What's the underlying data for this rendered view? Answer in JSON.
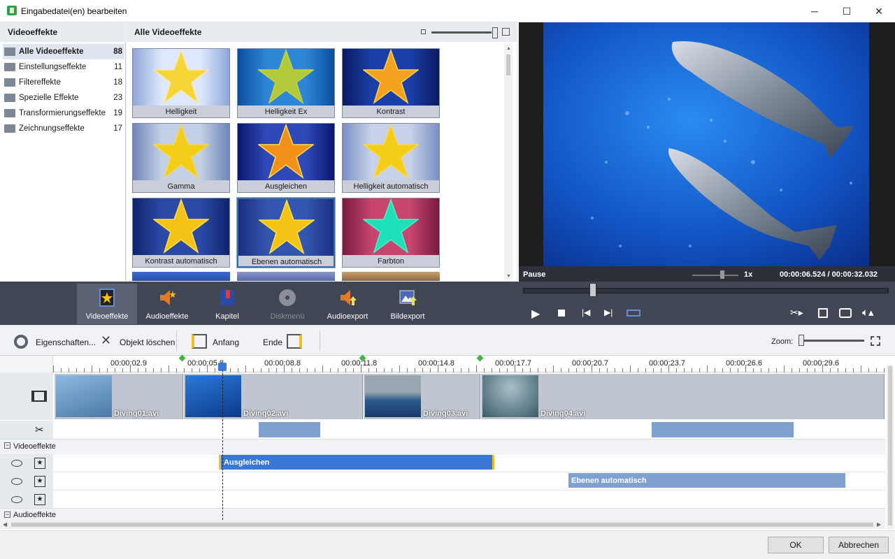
{
  "window": {
    "title": "Eingabedatei(en) bearbeiten",
    "minimize": "─",
    "maximize": "☐",
    "close": "✕"
  },
  "categories": {
    "header": "Videoeffekte",
    "items": [
      {
        "label": "Alle Videoeffekte",
        "count": "88"
      },
      {
        "label": "Einstellungseffekte",
        "count": "11"
      },
      {
        "label": "Filtereffekte",
        "count": "18"
      },
      {
        "label": "Spezielle Effekte",
        "count": "23"
      },
      {
        "label": "Transformierungseffekte",
        "count": "19"
      },
      {
        "label": "Zeichnungseffekte",
        "count": "17"
      }
    ]
  },
  "gallery": {
    "header": "Alle Videoeffekte",
    "tiles": [
      {
        "label": "Helligkeit",
        "colors": [
          "#dfe8ff",
          "#8ea7d8"
        ],
        "star": "#f6d636",
        "starEdge": "#f9e8a0"
      },
      {
        "label": "Helligkeit Ex",
        "colors": [
          "#2d86d6",
          "#0c4fa0"
        ],
        "star": "#b2c93a",
        "starEdge": "#c8d23c"
      },
      {
        "label": "Kontrast",
        "colors": [
          "#1b3fa8",
          "#0a1a60"
        ],
        "star": "#f2a21f",
        "starEdge": "#ffd24a"
      },
      {
        "label": "Gamma",
        "colors": [
          "#c4d0e6",
          "#6e86b8"
        ],
        "star": "#f4cc1a",
        "starEdge": "#f7d84a"
      },
      {
        "label": "Ausgleichen",
        "colors": [
          "#2f4ab8",
          "#0a1770"
        ],
        "star": "#f2911a",
        "starEdge": "#ffe04a"
      },
      {
        "label": "Helligkeit automatisch",
        "colors": [
          "#c7d2ea",
          "#7a90c4"
        ],
        "star": "#f4cc1a",
        "starEdge": "#f9da4a"
      },
      {
        "label": "Kontrast automatisch",
        "colors": [
          "#2b4aa6",
          "#0f246e"
        ],
        "star": "#f4c316",
        "starEdge": "#ffe04a"
      },
      {
        "label": "Ebenen automatisch",
        "colors": [
          "#3356b0",
          "#1a2f80"
        ],
        "star": "#f4c316",
        "starEdge": "#ffe04a"
      },
      {
        "label": "Farbton",
        "colors": [
          "#c8456e",
          "#7a1a40"
        ],
        "star": "#1ee0b8",
        "starEdge": "#50f0c8"
      }
    ]
  },
  "preview": {
    "status": "Pause",
    "speed": "1x",
    "time": "00:00:06.524 / 00:00:32.032",
    "seek_fraction": 0.19
  },
  "midbar": {
    "buttons": [
      {
        "label": "Videoeffekte",
        "active": true
      },
      {
        "label": "Audioeffekte"
      },
      {
        "label": "Kapitel"
      },
      {
        "label": "Diskmenü",
        "disabled": true
      },
      {
        "label": "Audioexport"
      },
      {
        "label": "Bildexport"
      }
    ]
  },
  "toolbar": {
    "properties": "Eigenschaften...",
    "delete": "Objekt löschen",
    "start": "Anfang",
    "end": "Ende",
    "zoom": "Zoom:"
  },
  "timeline": {
    "ticks": [
      "00:00:02.9",
      "00:00:05.8",
      "00:00:08.8",
      "00:00:11.8",
      "00:00:14.8",
      "00:00:17.7",
      "00:00:20.7",
      "00:00:23.7",
      "00:00:26.6",
      "00:00:29.6"
    ],
    "clips": [
      "Diving01.avi",
      "Diving02.avi",
      "Diving03.avi",
      "Diving04.avi"
    ],
    "section_video": "Videoeffekte",
    "section_audio": "Audioeffekte",
    "effects": [
      "Ausgleichen",
      "Ebenen automatisch"
    ]
  },
  "footer": {
    "ok": "OK",
    "cancel": "Abbrechen"
  }
}
